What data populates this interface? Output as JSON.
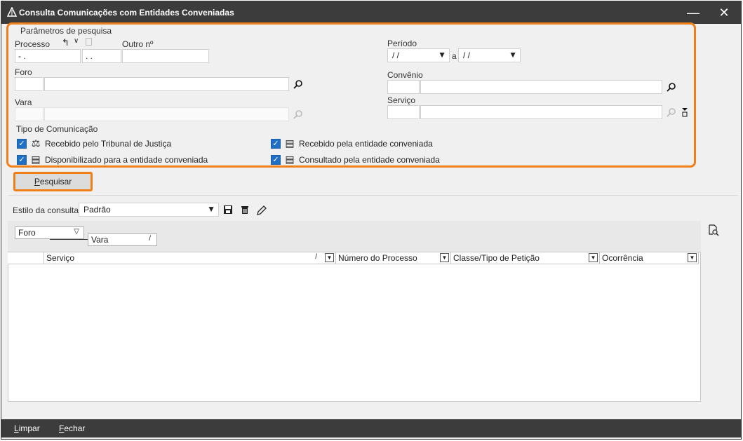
{
  "window": {
    "title": "Consulta Comunicações com Entidades Conveniadas",
    "minimize_glyph": "—",
    "close_glyph": "✕"
  },
  "params": {
    "legend": "Parâmetros de pesquisa",
    "processo_label": "Processo",
    "processo_value1": "  -  .",
    "processo_value2": "  .  .",
    "outro_label": "Outro nº",
    "outro_value": "",
    "periodo_label": "Período",
    "periodo_from": "/ /",
    "periodo_sep": "a",
    "periodo_to": "/ /",
    "foro_label": "Foro",
    "convenio_label": "Convênio",
    "vara_label": "Vara",
    "servico_label": "Serviço",
    "tipo_label": "Tipo de Comunicação",
    "checkboxes": [
      {
        "label": "Recebido pelo Tribunal de Justiça",
        "checked": true
      },
      {
        "label": "Disponibilizado para a entidade conveniada",
        "checked": true
      },
      {
        "label": "Recebido pela entidade conveniada",
        "checked": true
      },
      {
        "label": "Consultado pela entidade conveniada",
        "checked": true
      }
    ]
  },
  "pesquisar_button": {
    "underline": "P",
    "rest": "esquisar"
  },
  "estilo": {
    "label": "Estilo da consulta",
    "value": "Padrão"
  },
  "grid": {
    "group_chips": [
      {
        "label": "Foro",
        "sort": "▽"
      },
      {
        "label": "Vara",
        "sort": "/"
      }
    ],
    "columns": [
      {
        "label": "Serviço",
        "sort": "/"
      },
      {
        "label": "Número do Processo"
      },
      {
        "label": "Classe/Tipo de Petição"
      },
      {
        "label": "Ocorrência"
      }
    ]
  },
  "footer": {
    "limpar_underline": "L",
    "limpar_rest": "impar",
    "fechar_underline": "F",
    "fechar_rest": "echar"
  },
  "colors": {
    "accent_orange": "#f07f1a",
    "titlebar": "#3c3c3c",
    "checkbox_blue": "#1f6fc5"
  }
}
